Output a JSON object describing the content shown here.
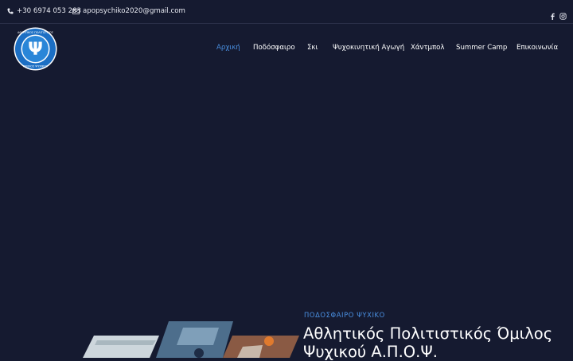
{
  "topbar": {
    "phone": "+30 6974 053 283",
    "email": "apopsychiko2020@gmail.com",
    "social_icons": [
      "facebook-icon",
      "instagram-icon"
    ]
  },
  "logo": {
    "ring_text_top": "ΑΘΛΗΤΙΚΟΣ ΠΟΛΙΤΙΣΤΙΚΟΣ",
    "ring_text_bottom": "ΟΜΙΛΟΣ ΨΥΧΙΚΟΥ",
    "symbol": "Ψ"
  },
  "nav": {
    "items": [
      {
        "label": "Αρχική",
        "active": true
      },
      {
        "label": "Ποδόσφαιρο",
        "active": false
      },
      {
        "label": "Σκι",
        "active": false
      },
      {
        "label": "Ψυχοκινητική Αγωγή",
        "active": false
      },
      {
        "label": "Χάντμπολ",
        "active": false
      },
      {
        "label": "Summer Camp",
        "active": false
      },
      {
        "label": "Επικοινωνία",
        "active": false
      }
    ]
  },
  "hero": {
    "kicker": "ΠΟΔΟΣΦΑΙΡΟ ΨΥΧΙΚΟ",
    "title": "Αθλητικός Πολιτιστικός Όμιλος Ψυχικού Α.Π.Ο.Ψ."
  },
  "colors": {
    "background": "#151a30",
    "accent": "#4a90e2",
    "text": "#ffffff"
  }
}
